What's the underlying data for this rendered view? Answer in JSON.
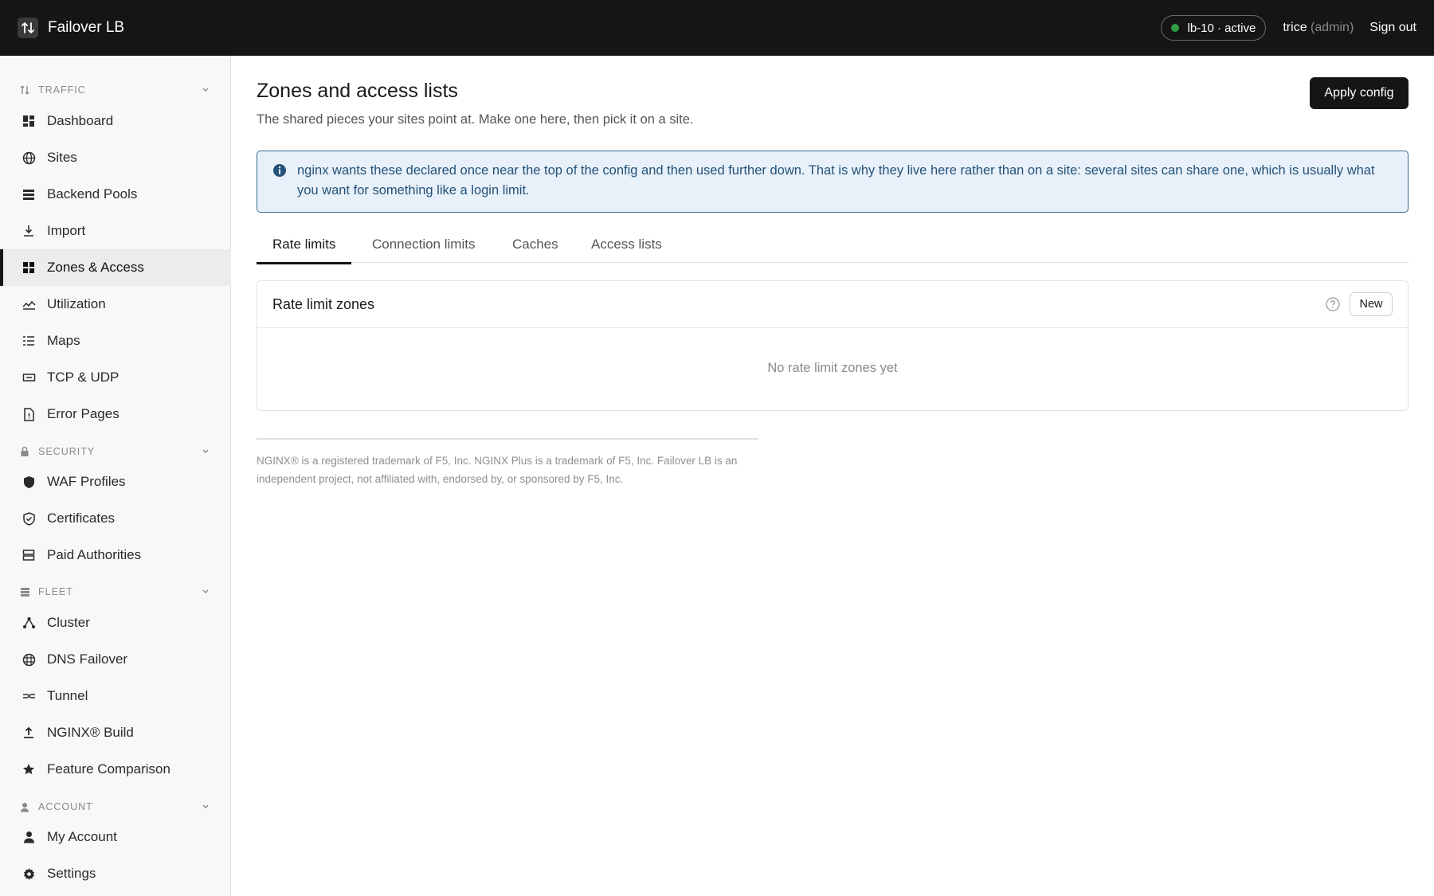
{
  "topbar": {
    "app_name": "Failover LB",
    "status": "lb-10 · active",
    "status_color": "#2f9e44",
    "user_name": "trice",
    "user_role": "(admin)",
    "sign_out": "Sign out"
  },
  "sidebar": {
    "sections": [
      {
        "label": "TRAFFIC",
        "icon": "arrows-up-down-icon"
      },
      {
        "label": "SECURITY",
        "icon": "lock-icon"
      },
      {
        "label": "FLEET",
        "icon": "servers-icon"
      },
      {
        "label": "ACCOUNT",
        "icon": "user-icon"
      }
    ],
    "items": [
      {
        "label": "Dashboard",
        "icon": "dashboard-icon"
      },
      {
        "label": "Sites",
        "icon": "globe-icon"
      },
      {
        "label": "Backend Pools",
        "icon": "stack-icon"
      },
      {
        "label": "Import",
        "icon": "download-icon"
      },
      {
        "label": "Zones & Access",
        "icon": "grid-icon",
        "active": true
      },
      {
        "label": "Utilization",
        "icon": "chart-line-icon"
      },
      {
        "label": "Maps",
        "icon": "list-icon"
      },
      {
        "label": "TCP & UDP",
        "icon": "connection-icon"
      },
      {
        "label": "Error Pages",
        "icon": "file-alert-icon"
      },
      {
        "label": "WAF Profiles",
        "icon": "shield-icon"
      },
      {
        "label": "Certificates",
        "icon": "shield-check-icon"
      },
      {
        "label": "Paid Authorities",
        "icon": "server-icon"
      },
      {
        "label": "Cluster",
        "icon": "cluster-icon"
      },
      {
        "label": "DNS Failover",
        "icon": "globe-grid-icon"
      },
      {
        "label": "Tunnel",
        "icon": "tunnel-icon"
      },
      {
        "label": "NGINX® Build",
        "icon": "upload-icon"
      },
      {
        "label": "Feature Comparison",
        "icon": "star-icon"
      },
      {
        "label": "My Account",
        "icon": "person-icon"
      },
      {
        "label": "Settings",
        "icon": "gear-icon"
      }
    ]
  },
  "main": {
    "title": "Zones and access lists",
    "subtitle": "The shared pieces your sites point at. Make one here, then pick it on a site.",
    "apply_label": "Apply config",
    "info_text": "nginx wants these declared once near the top of the config and then used further down. That is why they live here rather than on a site: several sites can share one, which is usually what you want for something like a login limit.",
    "tabs": [
      {
        "label": "Rate limits",
        "active": true
      },
      {
        "label": "Connection limits"
      },
      {
        "label": "Caches"
      },
      {
        "label": "Access lists"
      }
    ],
    "card": {
      "title": "Rate limit zones",
      "new_label": "New",
      "empty_text": "No rate limit zones yet"
    },
    "footer": "NGINX® is a registered trademark of F5, Inc. NGINX Plus is a trademark of F5, Inc. Failover LB is an independent project, not affiliated with, endorsed by, or sponsored by F5, Inc."
  }
}
